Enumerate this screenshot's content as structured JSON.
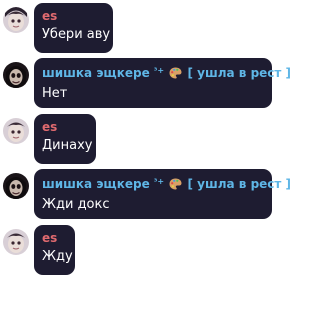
{
  "messages": [
    {
      "author": "es",
      "text": "Убери аву"
    },
    {
      "author": "шишка эщкере",
      "badge": "³+",
      "status": "[ ушла в рест ]",
      "text": "Нет"
    },
    {
      "author": "es",
      "text": "Динаху"
    },
    {
      "author": "шишка эщкере",
      "badge": "³+",
      "status": "[ ушла в рест ]",
      "text": "Жди докс"
    },
    {
      "author": "es",
      "text": "Жду"
    }
  ],
  "icons": {
    "avatar_es": "cartoon-face-avatar-icon",
    "avatar_sh": "momo-face-avatar-icon",
    "badge_emoji": "palette-icon"
  },
  "colors": {
    "bubble": "#1e1c31",
    "name_es": "#e06a6f",
    "name_sh": "#5fb6e6",
    "text": "#ffffff"
  }
}
